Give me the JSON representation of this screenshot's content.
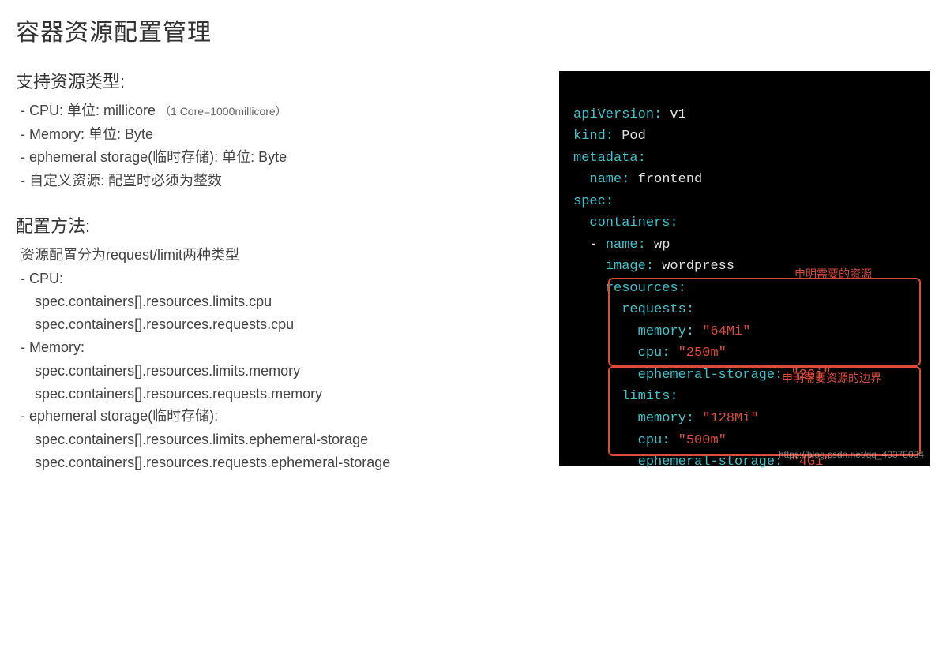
{
  "title": "容器资源配置管理",
  "sections": {
    "types": {
      "heading": "支持资源类型:",
      "items": [
        {
          "text": "- CPU:  单位: millicore ",
          "note": "（1 Core=1000millicore）"
        },
        {
          "text": "- Memory: 单位: Byte"
        },
        {
          "text": "- ephemeral storage(临时存储): 单位: Byte"
        },
        {
          "text": "- 自定义资源: 配置时必须为整数"
        }
      ]
    },
    "method": {
      "heading": "配置方法:",
      "intro": "资源配置分为request/limit两种类型",
      "groups": [
        {
          "label": "- CPU:",
          "paths": [
            "spec.containers[].resources.limits.cpu",
            "spec.containers[].resources.requests.cpu"
          ]
        },
        {
          "label": "- Memory:",
          "paths": [
            "spec.containers[].resources.limits.memory",
            "spec.containers[].resources.requests.memory"
          ]
        },
        {
          "label": "- ephemeral storage(临时存储):",
          "paths": [
            "spec.containers[].resources.limits.ephemeral-storage",
            "spec.containers[].resources.requests.ephemeral-storage"
          ]
        }
      ]
    }
  },
  "yaml": {
    "apiVersion": "v1",
    "kind": "Pod",
    "metadata_name": "frontend",
    "container_name": "wp",
    "image": "wordpress",
    "requests": {
      "memory": "\"64Mi\"",
      "cpu": "\"250m\"",
      "ephemeral": "\"2Gi\""
    },
    "limits": {
      "memory": "\"128Mi\"",
      "cpu": "\"500m\"",
      "ephemeral": "\"4Gi\""
    },
    "keys": {
      "apiVersion": "apiVersion:",
      "kind": "kind:",
      "metadata": "metadata:",
      "name": "name:",
      "spec": "spec:",
      "containers": "containers:",
      "dash_name": "- name:",
      "image": "image:",
      "resources": "resources:",
      "requests": "requests:",
      "limits": "limits:",
      "memory": "memory:",
      "cpu": "cpu:",
      "ephemeral": "ephemeral-storage:"
    }
  },
  "annotations": {
    "req": "申明需要的资源",
    "lim": "申明需要资源的边界"
  },
  "watermark": "https://blog.csdn.net/qq_40378034"
}
